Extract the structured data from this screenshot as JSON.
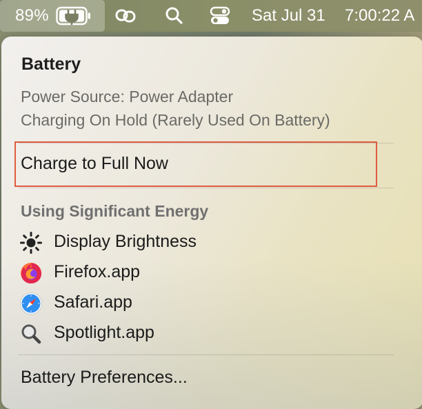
{
  "menubar": {
    "battery_percent": "89%",
    "date": "Sat Jul 31",
    "time": "7:00:22 A",
    "icons": [
      "battery-charging-icon",
      "link-icon",
      "search-icon",
      "control-center-icon"
    ]
  },
  "battery_menu": {
    "title": "Battery",
    "power_source": "Power Source: Power Adapter",
    "charging_status": "Charging On Hold (Rarely Used On Battery)",
    "charge_full_label": "Charge to Full Now",
    "energy_section_title": "Using Significant Energy",
    "energy_items": [
      {
        "label": "Display Brightness",
        "icon": "sun-icon"
      },
      {
        "label": "Firefox.app",
        "icon": "firefox-icon"
      },
      {
        "label": "Safari.app",
        "icon": "safari-icon"
      },
      {
        "label": "Spotlight.app",
        "icon": "spotlight-icon"
      }
    ],
    "preferences_label": "Battery Preferences..."
  },
  "colors": {
    "highlight_border": "#e05a40",
    "menu_text": "#1a1a1a",
    "secondary_text": "#6a6a66"
  }
}
